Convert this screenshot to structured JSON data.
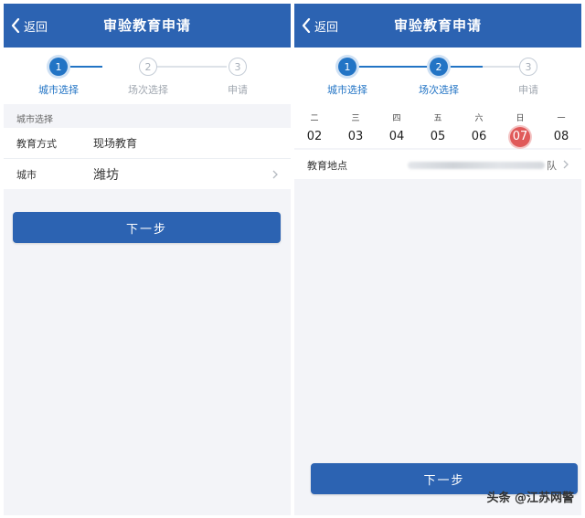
{
  "left": {
    "nav": {
      "back_label": "返回",
      "title": "审验教育申请"
    },
    "steps": [
      {
        "number": "1",
        "label": "城市选择",
        "state": "active"
      },
      {
        "number": "2",
        "label": "场次选择",
        "state": "inactive"
      },
      {
        "number": "3",
        "label": "申请",
        "state": "inactive"
      }
    ],
    "section_label": "城市选择",
    "form": {
      "education_mode": {
        "label": "教育方式",
        "value": "现场教育"
      },
      "city": {
        "label": "城市",
        "value": "潍坊"
      }
    },
    "next_button": "下一步"
  },
  "right": {
    "nav": {
      "back_label": "返回",
      "title": "审验教育申请"
    },
    "steps": [
      {
        "number": "1",
        "label": "城市选择",
        "state": "active"
      },
      {
        "number": "2",
        "label": "场次选择",
        "state": "active"
      },
      {
        "number": "3",
        "label": "申请",
        "state": "inactive"
      }
    ],
    "dates": [
      {
        "weekday": "二",
        "day": "02"
      },
      {
        "weekday": "三",
        "day": "03"
      },
      {
        "weekday": "四",
        "day": "04"
      },
      {
        "weekday": "五",
        "day": "05"
      },
      {
        "weekday": "六",
        "day": "06"
      },
      {
        "weekday": "日",
        "day": "07",
        "selected": true
      },
      {
        "weekday": "一",
        "day": "08"
      }
    ],
    "location": {
      "label": "教育地点",
      "value_suffix": "队"
    },
    "next_button": "下一步"
  },
  "watermark": "头条 @江苏网警",
  "colors": {
    "nav_bar": "#2c63b2",
    "step_active": "#2274c5",
    "selected_date": "#e05a5a",
    "background": "#f3f4f8"
  }
}
